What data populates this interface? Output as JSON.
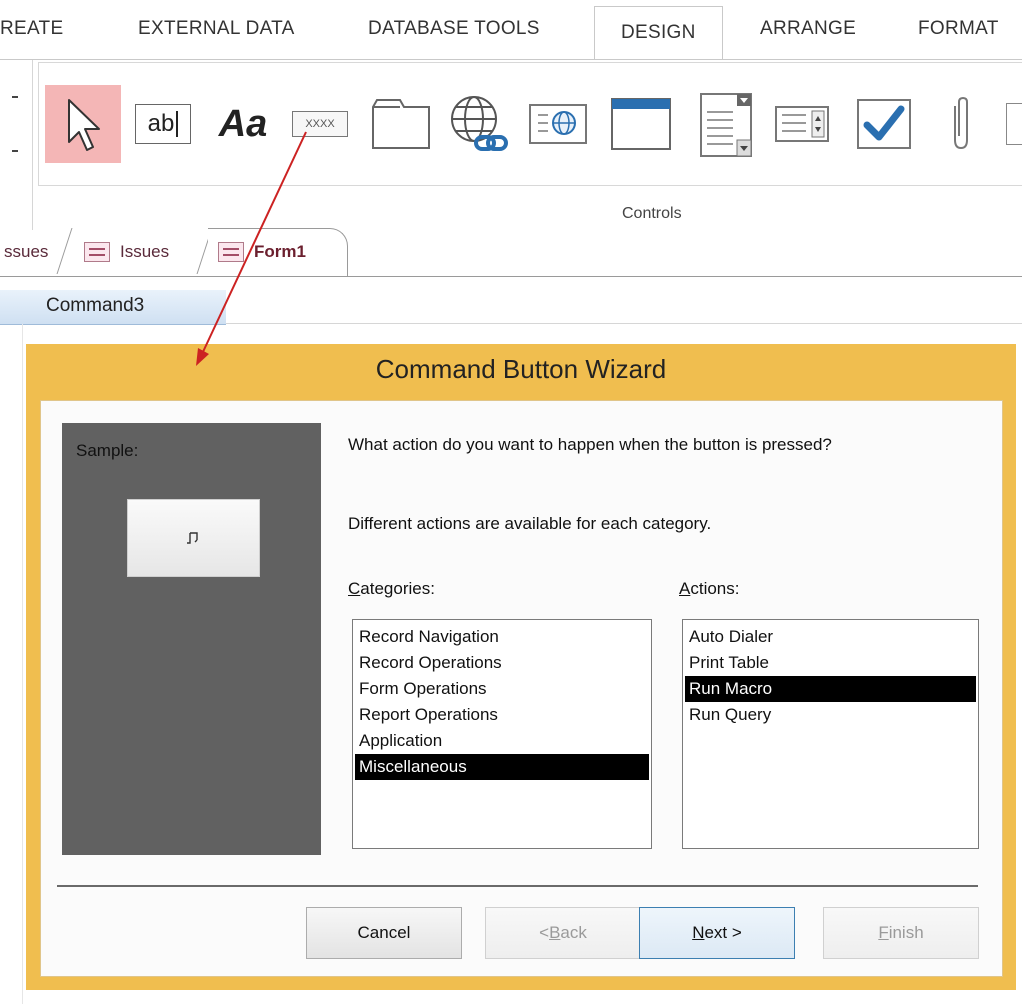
{
  "ribbon": {
    "tabs": [
      {
        "label": "REATE"
      },
      {
        "label": "EXTERNAL DATA"
      },
      {
        "label": "DATABASE TOOLS"
      },
      {
        "label": "DESIGN"
      },
      {
        "label": "ARRANGE"
      },
      {
        "label": "FORMAT"
      }
    ],
    "active_tab": "DESIGN",
    "group_label": "Controls",
    "controls": [
      {
        "icon": "select-arrow-icon",
        "text": ""
      },
      {
        "icon": "textbox-icon",
        "text": "ab"
      },
      {
        "icon": "label-icon",
        "text": "Aa"
      },
      {
        "icon": "button-control-icon",
        "text": "XXXX"
      },
      {
        "icon": "tab-control-icon",
        "text": ""
      },
      {
        "icon": "hyperlink-icon",
        "text": ""
      },
      {
        "icon": "web-browser-icon",
        "text": ""
      },
      {
        "icon": "navigation-control-icon",
        "text": ""
      },
      {
        "icon": "combo-box-icon",
        "text": ""
      },
      {
        "icon": "list-box-icon",
        "text": ""
      },
      {
        "icon": "checkbox-icon",
        "text": ""
      },
      {
        "icon": "attachment-icon",
        "text": ""
      }
    ],
    "selected_control_color": "#f4b6b6"
  },
  "doc_tabs": [
    {
      "label": "ssues"
    },
    {
      "label": "Issues"
    },
    {
      "label": "Form1"
    }
  ],
  "active_doc_tab": "Form1",
  "control_name": "Command3",
  "wizard": {
    "title": "Command Button Wizard",
    "sample_label": "Sample:",
    "question": "What action do you want to happen when the button is pressed?",
    "hint": "Different actions are available for each category.",
    "categories_label": "Categories:",
    "actions_label": "Actions:",
    "categories": [
      {
        "label": "Record Navigation"
      },
      {
        "label": "Record Operations"
      },
      {
        "label": "Form Operations"
      },
      {
        "label": "Report Operations"
      },
      {
        "label": "Application"
      },
      {
        "label": "Miscellaneous"
      }
    ],
    "selected_category": "Miscellaneous",
    "actions": [
      {
        "label": "Auto Dialer"
      },
      {
        "label": "Print Table"
      },
      {
        "label": "Run Macro"
      },
      {
        "label": "Run Query"
      }
    ],
    "selected_action": "Run Macro",
    "buttons": {
      "cancel": "Cancel",
      "back": "< Back",
      "next": "Next >",
      "finish": "Finish"
    },
    "frame_color": "#f0be4f"
  },
  "annotation_arrow_color": "#cc2222"
}
